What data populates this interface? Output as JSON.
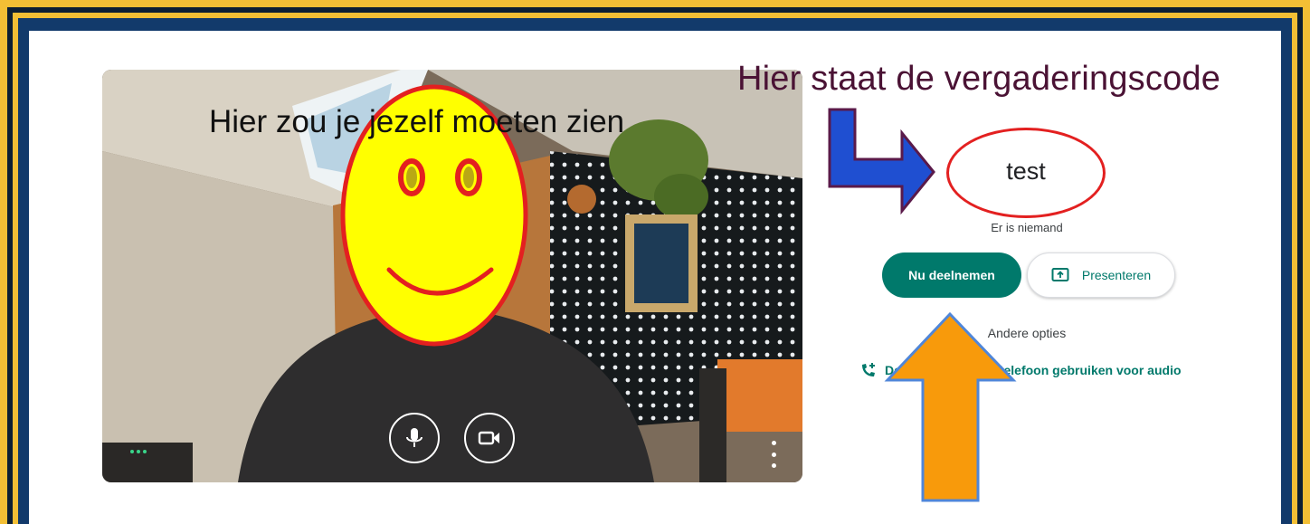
{
  "annotations": {
    "self_view_caption": "Hier zou je jezelf moeten zien",
    "code_caption": "Hier staat de vergaderingscode"
  },
  "meeting": {
    "code": "test",
    "status": "Er is niemand",
    "join_label": "Nu deelnemen",
    "present_label": "Presenteren",
    "other_options_label": "Andere opties",
    "phone_audio_label": "Deelnemen en een telefoon gebruiken voor audio"
  },
  "preview": {
    "controls": [
      "mic-icon",
      "video-camera-icon",
      "more-vert-icon"
    ]
  },
  "colors": {
    "frame_gold": "#f3bf35",
    "frame_navy": "#123a6b",
    "accent_teal": "#00796b",
    "ellipse_red": "#e32020",
    "arrow_blue": "#1f4fd1",
    "arrow_orange": "#f89a0b",
    "smiley_yellow": "#ffff00"
  }
}
